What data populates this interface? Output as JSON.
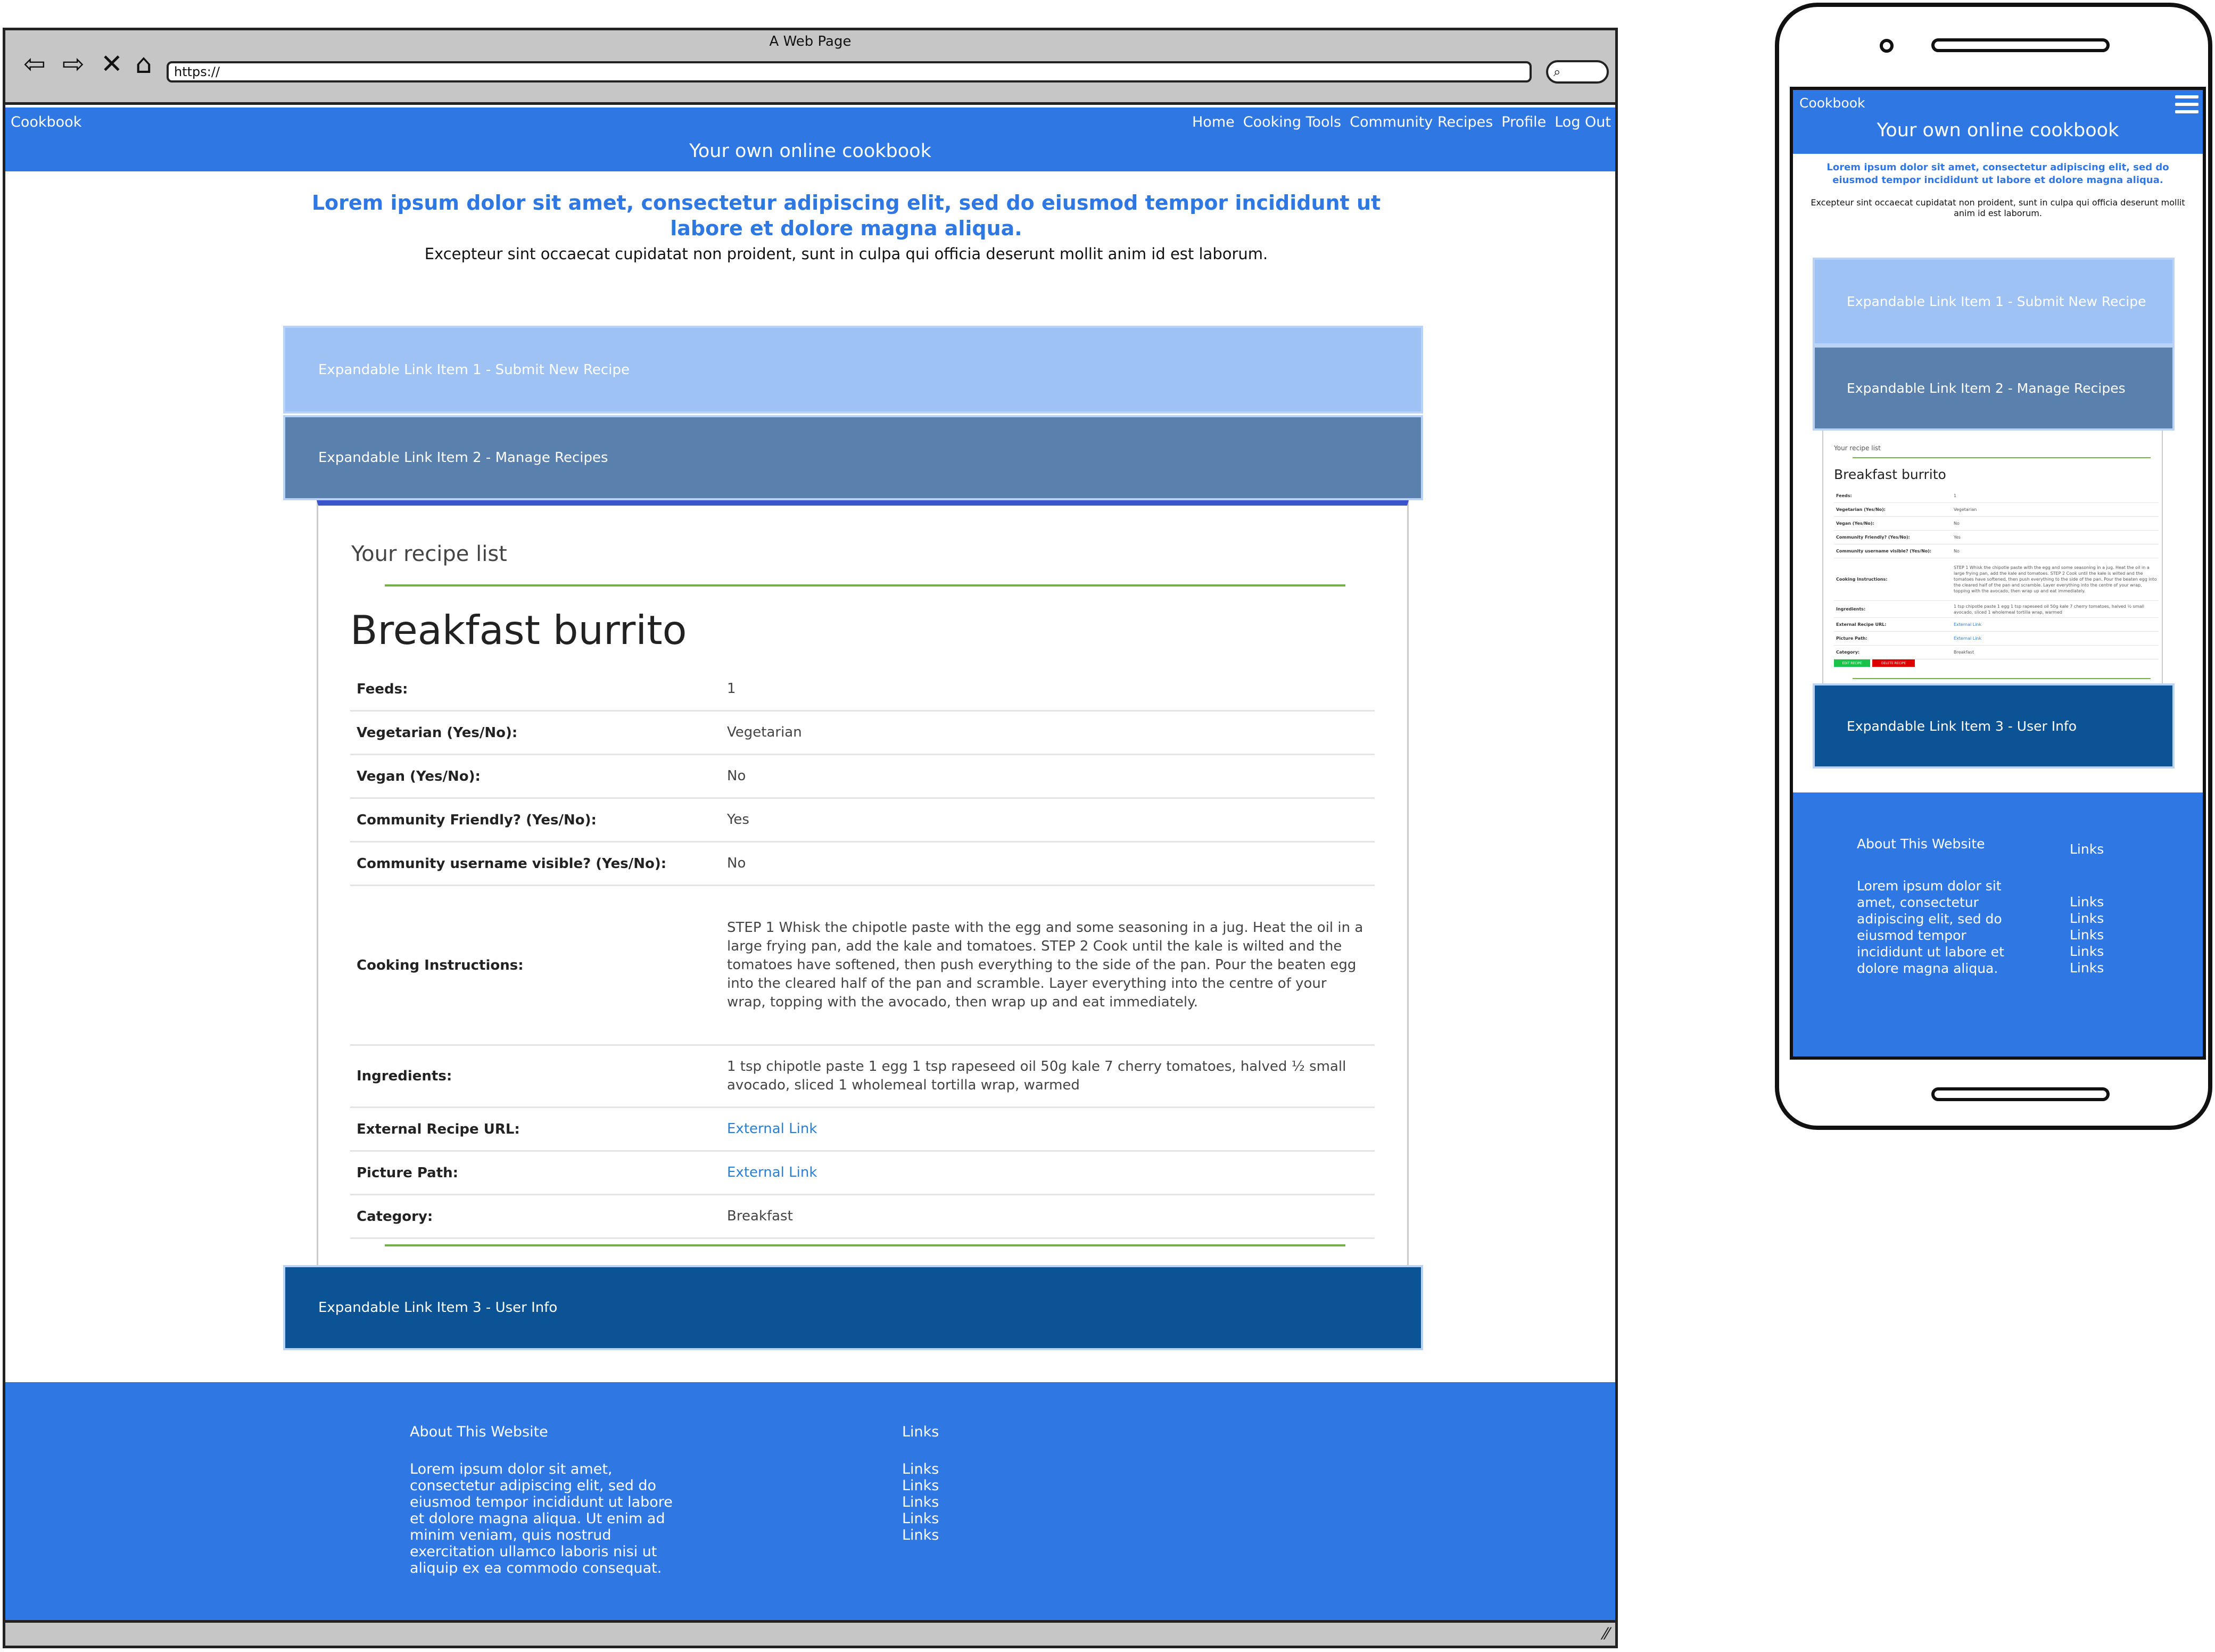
{
  "browser": {
    "window_title": "A Web Page",
    "url": "https://",
    "nav": {
      "back_icon": "⇦",
      "forward_icon": "⇨",
      "stop_icon": "✕",
      "home_icon": "⌂",
      "search_icon": "⌕"
    }
  },
  "site": {
    "brand": "Cookbook",
    "menu": [
      "Home",
      "Cooking Tools",
      "Community Recipes",
      "Profile",
      "Log Out"
    ],
    "tagline": "Your own online cookbook",
    "hero_title": "Lorem ipsum dolor sit amet, consectetur adipiscing elit, sed do eiusmod tempor incididunt ut labore et dolore magna aliqua.",
    "hero_sub": "Excepteur sint occaecat cupidatat non proident, sunt in culpa qui officia deserunt mollit anim id est laborum."
  },
  "accordion": {
    "item1": "Expandable Link Item 1 - Submit New Recipe",
    "item2": "Expandable Link Item 2 - Manage Recipes",
    "item3": "Expandable Link Item 3 - User Info"
  },
  "recipe_panel": {
    "heading": "Your recipe list",
    "title": "Breakfast burrito",
    "rows": [
      {
        "label": "Feeds:",
        "value": "1"
      },
      {
        "label": "Vegetarian (Yes/No):",
        "value": "Vegetarian"
      },
      {
        "label": "Vegan (Yes/No):",
        "value": "No"
      },
      {
        "label": "Community Friendly? (Yes/No):",
        "value": "Yes"
      },
      {
        "label": "Community username visible? (Yes/No):",
        "value": "No"
      },
      {
        "label": "Cooking Instructions:",
        "value": "STEP 1 Whisk the chipotle paste with the egg and some seasoning in a jug. Heat the oil in a large frying pan, add the kale and tomatoes. STEP 2 Cook until the kale is wilted and the tomatoes have softened, then push everything to the side of the pan. Pour the beaten egg into the cleared half of the pan and scramble. Layer everything into the centre of your wrap, topping with the avocado, then wrap up and eat immediately."
      },
      {
        "label": "Ingredients:",
        "value": "1 tsp chipotle paste 1 egg 1 tsp rapeseed oil 50g kale 7 cherry tomatoes, halved ½ small avocado, sliced 1 wholemeal tortilla wrap, warmed"
      },
      {
        "label": "External Recipe URL:",
        "value": "External Link"
      },
      {
        "label": "Picture Path:",
        "value": "External Link"
      },
      {
        "label": "Category:",
        "value": "Breakfast"
      }
    ],
    "edit_label": "EDIT RECIPE",
    "delete_label": "DELETE RECIPE"
  },
  "footer": {
    "about_heading": "About This Website",
    "about_text": "Lorem ipsum dolor sit amet, consectetur adipiscing elit, sed do eiusmod tempor incididunt ut labore et dolore magna aliqua. Ut enim ad minim veniam, quis nostrud exercitation ullamco laboris nisi ut aliquip ex ea commodo consequat.",
    "links_heading": "Links",
    "links": [
      "Links",
      "Links",
      "Links",
      "Links",
      "Links"
    ]
  },
  "mobile": {
    "footer_about_text": "Lorem ipsum dolor sit amet, consectetur adipiscing elit, sed do eiusmod tempor incididunt ut labore et dolore magna aliqua."
  },
  "colors": {
    "brand_blue": "#2f78e4",
    "accordion_light": "#9fc2f5",
    "accordion_mid": "#5a80ad",
    "accordion_dark": "#0c5396",
    "edit_green": "#19c34a",
    "delete_red": "#dd0000"
  }
}
